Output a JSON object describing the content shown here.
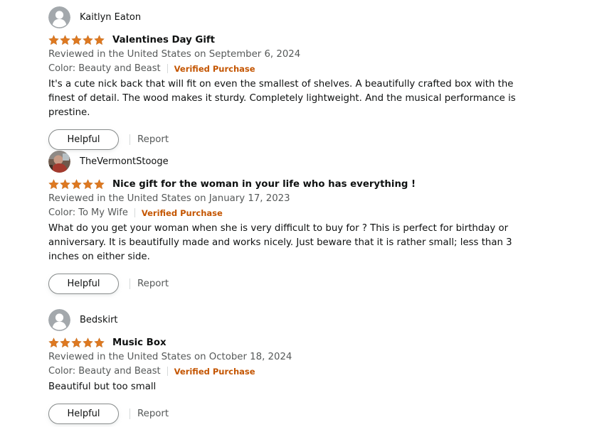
{
  "colors": {
    "star": "#de7921",
    "verified": "#c45500",
    "secondary_text": "#565959",
    "primary_text": "#0f1111"
  },
  "reviews": [
    {
      "profile_name": "Kaitlyn Eaton",
      "avatar": "default-avatar-icon",
      "rating": 5,
      "title": "Valentines Day Gift",
      "date": "Reviewed in the United States on September 6, 2024",
      "variant": "Color: Beauty and Beast",
      "verified": "Verified Purchase",
      "body": "It's a cute nick back that will fit on even the smallest of shelves. A beautifully crafted box with the finest of detail. The wood makes it sturdy. Completely lightweight. And the musical performance is prestine.",
      "helpful_label": "Helpful",
      "report_label": "Report"
    },
    {
      "profile_name": "TheVermontStooge",
      "avatar": "photo-avatar-icon",
      "rating": 5,
      "title": "Nice gift for the woman in your life who has everything !",
      "date": "Reviewed in the United States on January 17, 2023",
      "variant": "Color: To My Wife",
      "verified": "Verified Purchase",
      "body": "What do you get your woman when she is very difficult to buy for ? This is perfect for birthday or anniversary. It is beautifully made and works nicely. Just beware that it is rather small; less than 3 inches on either side.",
      "helpful_label": "Helpful",
      "report_label": "Report"
    },
    {
      "profile_name": "Bedskirt",
      "avatar": "default-avatar-icon",
      "rating": 5,
      "title": "Music Box",
      "date": "Reviewed in the United States on October 18, 2024",
      "variant": "Color: Beauty and Beast",
      "verified": "Verified Purchase",
      "body": "Beautiful but too small",
      "helpful_label": "Helpful",
      "report_label": "Report"
    }
  ]
}
